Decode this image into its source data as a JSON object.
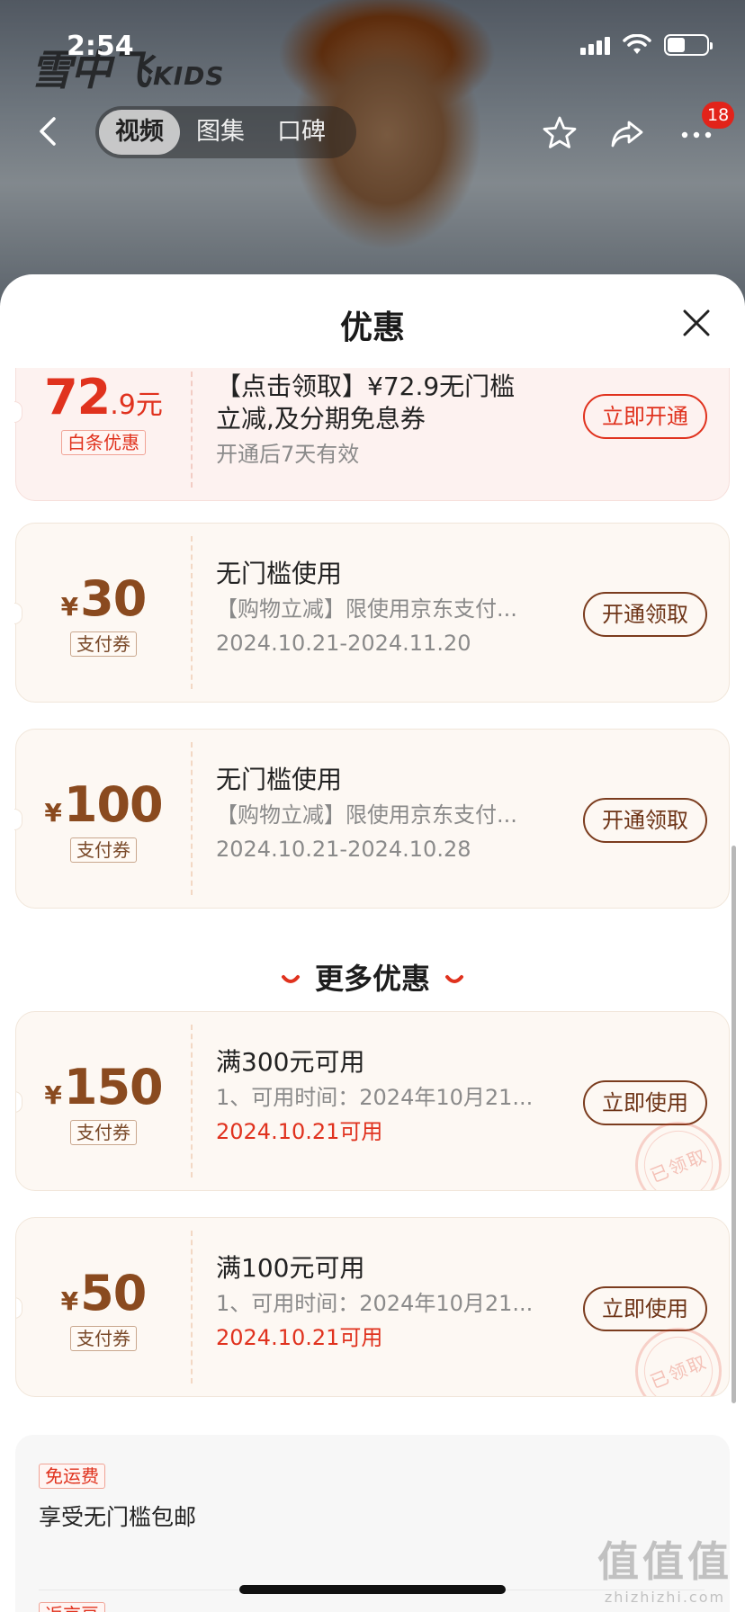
{
  "status_bar": {
    "time": "2:54"
  },
  "background": {
    "brand_text": "雪中飞",
    "brand_sub": "KIDS"
  },
  "nav": {
    "tabs": [
      {
        "label": "视频",
        "active": true
      },
      {
        "label": "图集",
        "active": false
      },
      {
        "label": "口碑",
        "active": false
      }
    ],
    "icons": [
      "back-icon",
      "star-icon",
      "share-icon",
      "more-icon"
    ],
    "badge_count": "18"
  },
  "sheet": {
    "title": "优惠",
    "close_icon": "close-icon"
  },
  "coupons": [
    {
      "currency": "",
      "amount_int": "72",
      "amount_dec": ".9元",
      "tag": "白条优惠",
      "title": "【点击领取】¥72.9无门槛立减,及分期免息券",
      "desc": "",
      "date": "开通后7天有效",
      "button": "立即开通",
      "style": "pink"
    },
    {
      "currency": "¥",
      "amount_int": "30",
      "tag": "支付券",
      "title": "无门槛使用",
      "desc": "【购物立减】限使用京东支付...",
      "date": "2024.10.21-2024.11.20",
      "button": "开通领取"
    },
    {
      "currency": "¥",
      "amount_int": "100",
      "tag": "支付券",
      "title": "无门槛使用",
      "desc": "【购物立减】限使用京东支付...",
      "date": "2024.10.21-2024.10.28",
      "button": "开通领取"
    }
  ],
  "more_section": {
    "label": "更多优惠"
  },
  "more_coupons": [
    {
      "currency": "¥",
      "amount_int": "150",
      "tag": "支付券",
      "title": "满300元可用",
      "desc": "1、可用时间：2024年10月21...",
      "date": "2024.10.21可用",
      "button": "立即使用",
      "stamp": "已领取"
    },
    {
      "currency": "¥",
      "amount_int": "50",
      "tag": "支付券",
      "title": "满100元可用",
      "desc": "1、可用时间：2024年10月21...",
      "date": "2024.10.21可用",
      "button": "立即使用",
      "stamp": "已领取"
    }
  ],
  "perks": [
    {
      "tag": "免运费",
      "text": "享受无门槛包邮"
    },
    {
      "tag": "返京豆",
      "text": ""
    }
  ],
  "watermark": {
    "text": "值值值",
    "sub": "zhizhizhi.com"
  },
  "colors": {
    "accent_red": "#e0321e",
    "brown": "#8a4a1f",
    "badge": "#e2231a"
  }
}
